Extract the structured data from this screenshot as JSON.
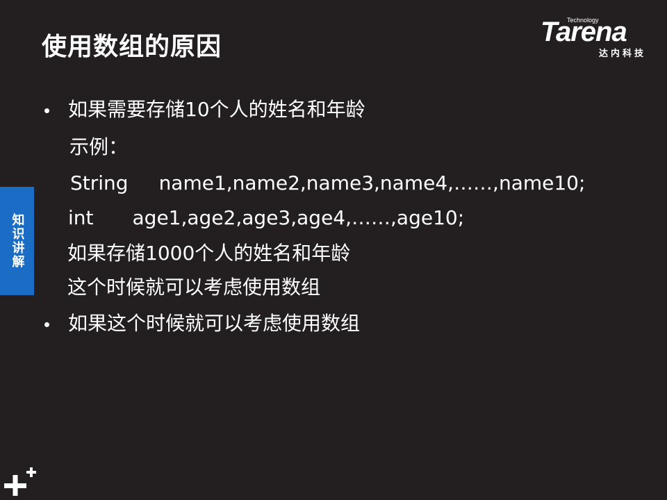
{
  "slide": {
    "title": "使用数组的原因"
  },
  "logo": {
    "technology": "Technology",
    "brand": "Tarena",
    "subtitle": "达内科技"
  },
  "side_tab": {
    "label": "知识讲解"
  },
  "content": {
    "bullet1": "如果需要存储10个人的姓名和年龄",
    "example_label": "示例：",
    "code_line1": {
      "type": "String",
      "vars": "name1,name2,name3,name4,……,name10;"
    },
    "code_line2": {
      "type": "int",
      "vars": "age1,age2,age3,age4,……,age10;"
    },
    "line_store_1000": "如果存储1000个人的姓名和年龄",
    "line_consider": "这个时候就可以考虑使用数组",
    "bullet2": "如果这个时候就可以考虑使用数组"
  },
  "icons": {
    "corner": "plus-icon",
    "bullets": "bullet-dot-icon"
  },
  "colors": {
    "background": "#231f20",
    "text": "#ffffff",
    "side_tab": "#1a6cc4"
  }
}
